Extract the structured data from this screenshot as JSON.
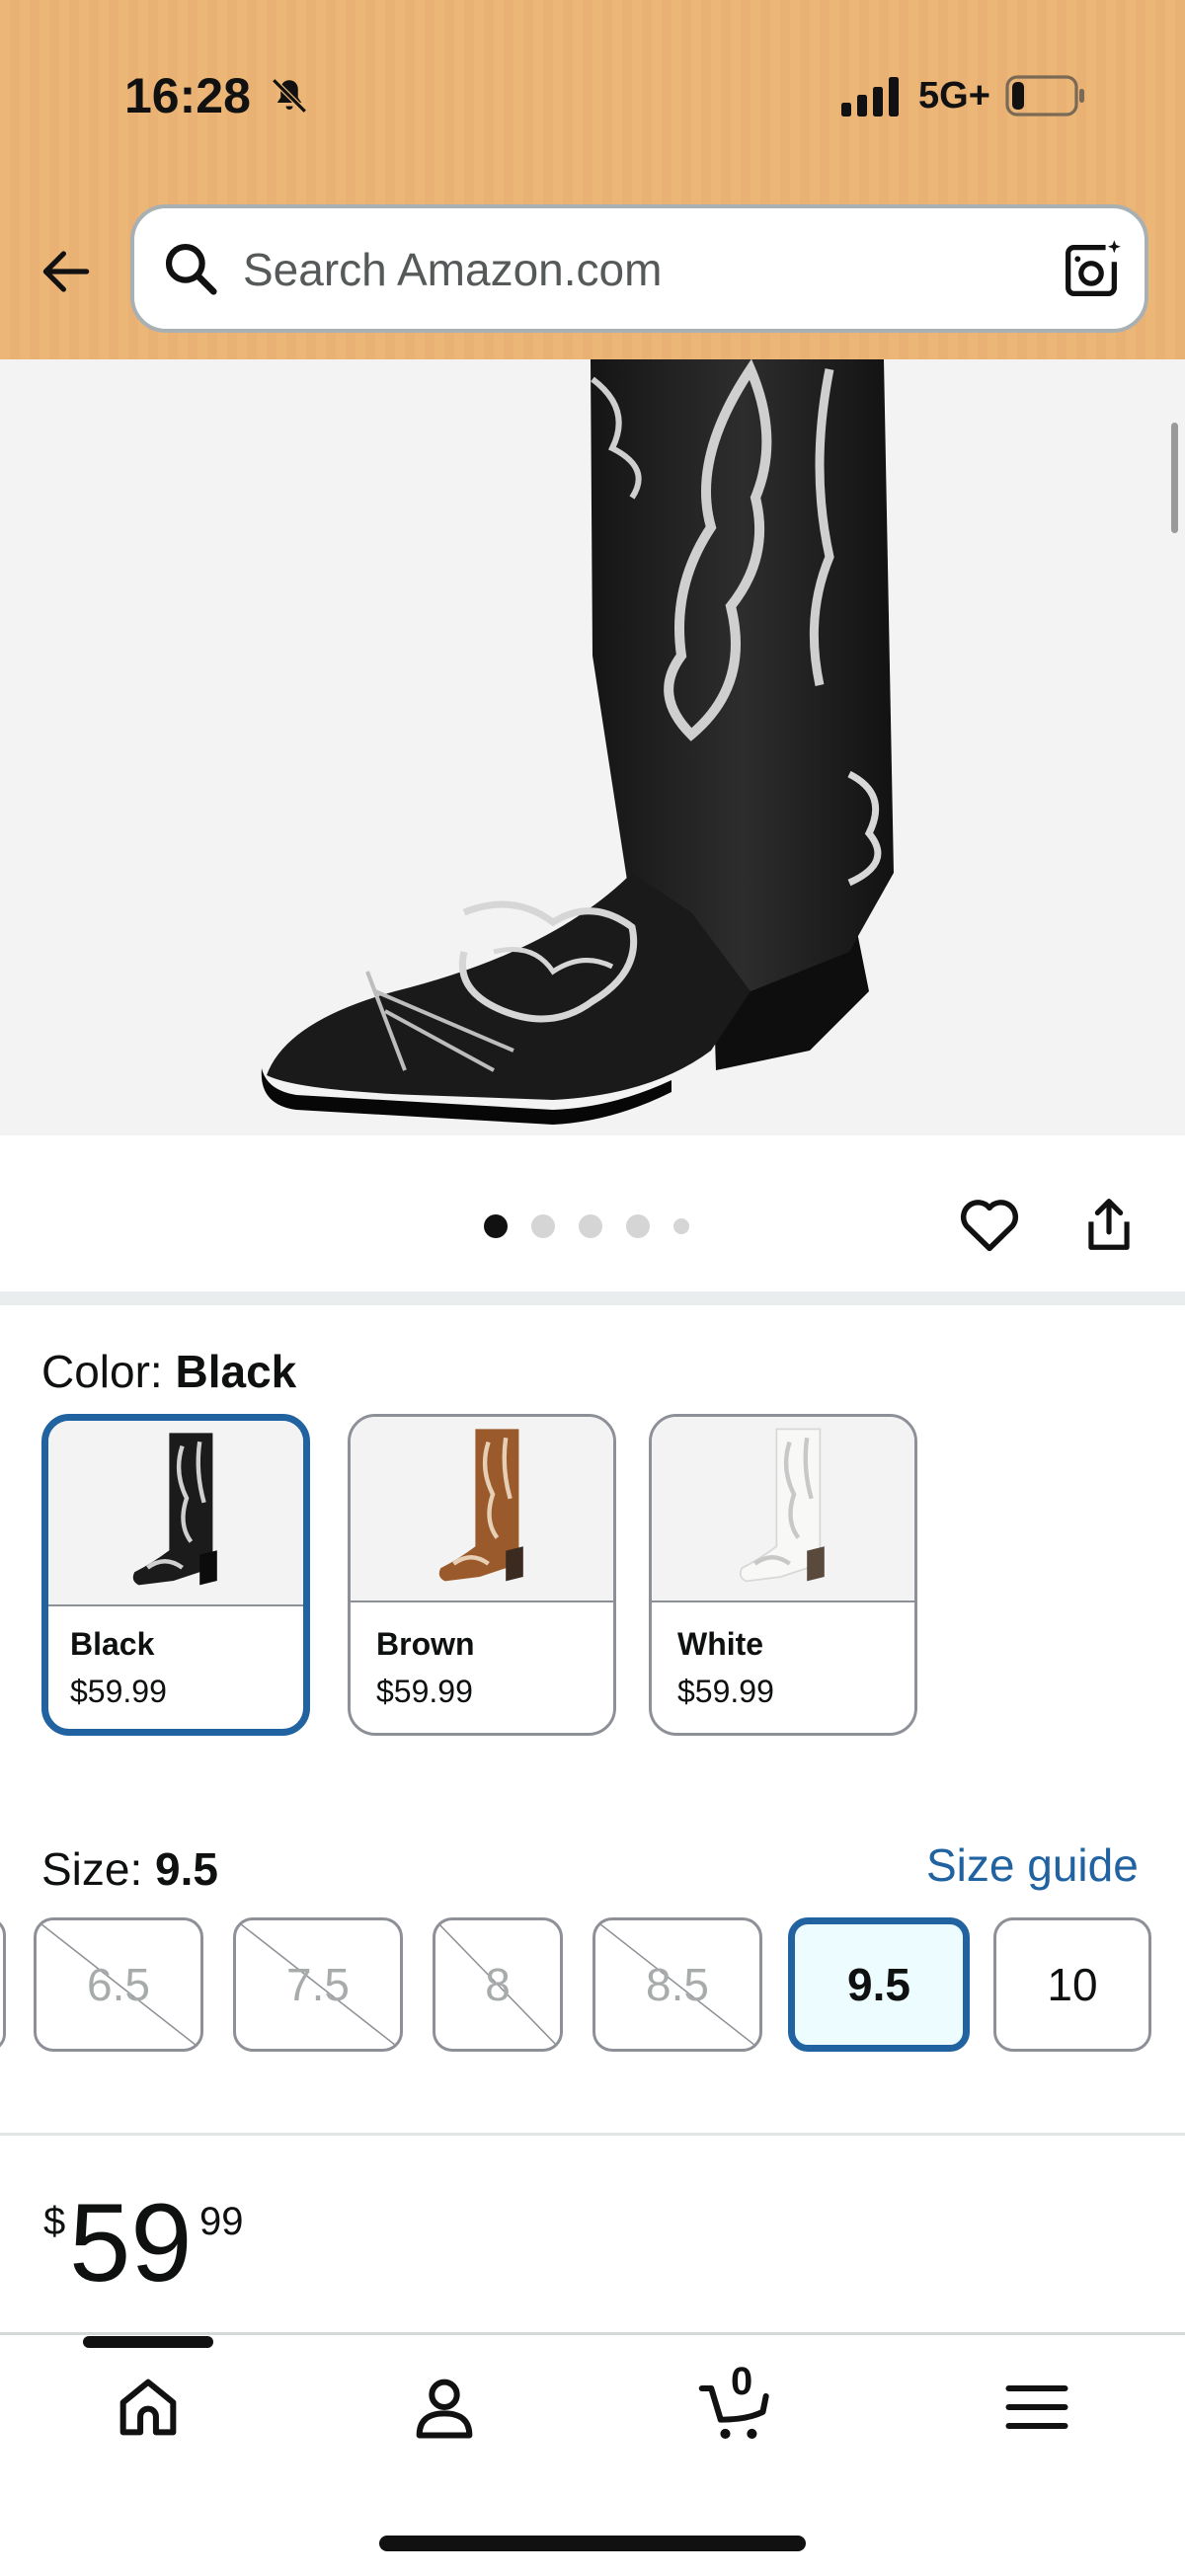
{
  "status_bar": {
    "time": "16:28",
    "network": "5G+"
  },
  "search": {
    "placeholder": "Search Amazon.com"
  },
  "gallery": {
    "image_count": 5,
    "active_index": 0
  },
  "color": {
    "label": "Color: ",
    "selected": "Black",
    "options": [
      {
        "name": "Black",
        "price": "$59.99"
      },
      {
        "name": "Brown",
        "price": "$59.99"
      },
      {
        "name": "White",
        "price": "$59.99"
      }
    ]
  },
  "size": {
    "label": "Size: ",
    "selected": "9.5",
    "guide_link": "Size guide",
    "options": [
      {
        "value": "6.5",
        "available": false
      },
      {
        "value": "7.5",
        "available": false
      },
      {
        "value": "8",
        "available": false
      },
      {
        "value": "8.5",
        "available": false
      },
      {
        "value": "9.5",
        "available": true
      },
      {
        "value": "10",
        "available": true
      }
    ]
  },
  "price": {
    "symbol": "$",
    "whole": "59",
    "fraction": "99"
  },
  "bottom_nav": {
    "items": [
      "home-icon",
      "account-icon",
      "cart-icon",
      "menu-icon"
    ],
    "cart_count": "0"
  },
  "colors": {
    "header_bg": "#ecb677",
    "selected_border": "#2162a1",
    "link": "#2162a1"
  }
}
